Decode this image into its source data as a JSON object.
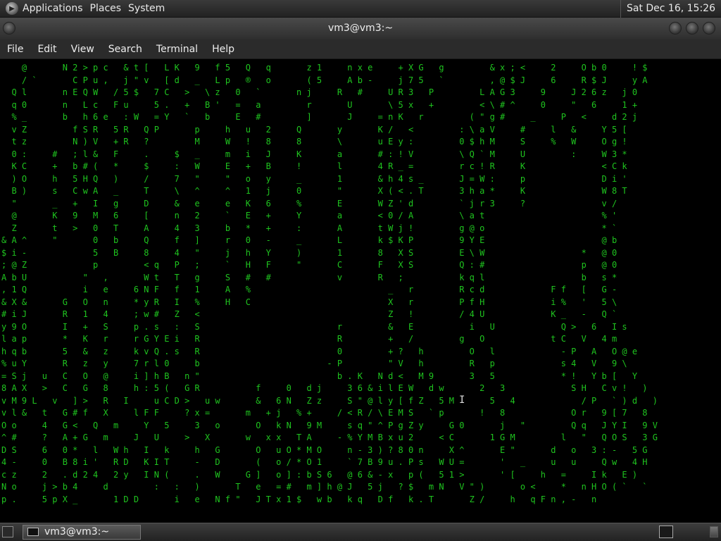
{
  "top_panel": {
    "menus": [
      "Applications",
      "Places",
      "System"
    ],
    "clock": "Sat Dec 16, 15:26"
  },
  "window": {
    "title": "vm3@vm3:~"
  },
  "menubar": {
    "items": [
      "File",
      "Edit",
      "View",
      "Search",
      "Terminal",
      "Help"
    ]
  },
  "terminal": {
    "text": "    @       N 2 > p c   & t [   L K   9   f 5   Q   q       z 1     n x e     + X G   g         & x ; <     2     O b 0     ! $\n    / `       C P u ,   j \" v   [ d   _   L p   ®   o       ( 5     A b -     j 7 5   `         , @ $ J     6     R $ J     y A\n  Q l       n E Q W   / 5 $   7 C   >   \\ z   0   `       n j     R   #     U R 3   P         L A G 3     9     J 2 6 z   j 0\n  q 0       n   L c   F u     5 .   +   B '   =   a         r       U       \\ 5 x   +         < \\ # ^     0     \"   6     1 +\n  % _       b   h 6 e   : W   = Y   `   b     E   #         ]       J     = n K   r         ( \" g #     _     P   <     d 2 j\n  v Z         f S R   5 R   Q P       p     h   u   2     Q       y       K /   <         : \\ a V     #     l   &     Y 5 [\n  t z         N ) V   + R   ?         M     W   !   8     8       \\       u E y :         0 $ h M     S     %   W     O g !\n  0 :     #   ; l &   F     .     $   _     m   i   J     K       a       # : ! V         \\ Q ` M     U         :     W 3 *\n  K C     +   b # (   *     $     :   W     E   +   B     !       l       4 R _ =         r c ! R     K               < C k\n  ) O     h   5 H Q   )     /     7   \"     \"   o   y     _       1       & h 4 s _       J = W :     p               D i '\n  B )     s   C w A   _     T     \\   ^     ^   1   j     0       \"       X ( < . T       3 h a *     K               W 8 T\n  \"       _   +   I   g     D     &   e     e   K   6     %       E       W Z ' d         ` j r 3     ?               v /\n  @       K   9   M   6     [     n   2     `   E   +     Y       a       < 0 / A         \\ a t                       % '\n  Z       t   >   0   T     A     4   3     b   *   +     :       A       t W j !         g @ o                       * `\n& A ^     \"       0   b     Q     f   ]     r   0   -     _       L       k $ K P         9 Y E                       @ b\n$ i -             5   B     8     4   \"     j   h   Y     )       1       8   X S         E \\ W                   *   @ 0\n; @ Z             p         < q   P   ;     `   H   F     \"       C       F   X S         Q : #                   p   @ 0\nA b U           \"   ,       W t   T   g     S   #   #             v       R   ;           k q l                   b   s *\n, 1 Q           i   e     6 N F   f   1     A   %                           _   r         R c d             F f   [   G -\n& X &       G   O   n     * y R   I   %     H   C                           X   r         P f H             i %   '   5 \\\n# i J       R   1   4     ; w #   Z   <                                     Z   !         / 4 U             K _   -   Q `\ny 9 O       I   +   S     p . s   :   S                           r         &   E           i   U             Q >   6   I s\nl a p       *   K   r     r G Y E i   R                           R         +   /         g   O             t C   V   4 m\nh q b       5   &   z     k v Q . s   R                           0         + ?   h         O   l             - P   A   O @ e\n% u Y       R   z   y     7 r l 0     b                         - P         \" V   h         R   p             s 4   V   9 \\\n= S j   u   C   O   @     i ] h B   n \"                           b . K   N d <   M 9       3   5             * !   Y b [   Y\n8 A X   >   C   G   8     h : 5 (   G R           f     0   d j     3 6 & i l E W   d w       2   3             S H   C v !   )\nv M 9 L   v   ] >   R   I     u C D >   u w       &   6 N   Z z     S \" @ l y [ f Z   5 M       5   4             / P   ` ) d   )\nv l &   t   G # f   X     l F F     ? x =       m   + j   % +     / < R / \\ E M S   ` p       !   8             O r   9 [ 7   8\nO o     4   G <   Q   m     Y   5     3   o       O   k N   9 M     s q \" ^ P g Z y     G 0       j   \"         Q q   J Y I   9 V\n^ #     ?   A + G   m     J   U     >   X       w   x x   T A     - % Y M B x u 2     < C       1 G M         l   \"   Q O S   3 G\nD S     6   0 *   l   W h   I   k     h   G       O   u O * M O     n - 3 ) ? 8 0 n     X ^       E \"       d   o   3 : -   5 G\n4 -     0   B 8 i '   R D   K I T     -   D       (   o / * O 1     ` 7 B 9 u . P s   W U =       '   _     u   u     Q w   4 H\nc z     2   . d 2 4   2 y   I N (     .   W     G ]   o ] : b S 6   @ 6 & - x   p (   5 1 >       ' [     h   =     I k   E )\nN o     j > b 4     d         :   :   )       T   e   = #   m ] h @ J   5 j   ? $   m N   V \" )       o <     *   n H O ( `   `\np .     5 p X _       1 D D       i   e   N f \"   J T x 1 $   w b   k q   D f   k . T       Z /     h   q F n , -   n"
  },
  "taskbar": {
    "task_label": "vm3@vm3:~"
  }
}
